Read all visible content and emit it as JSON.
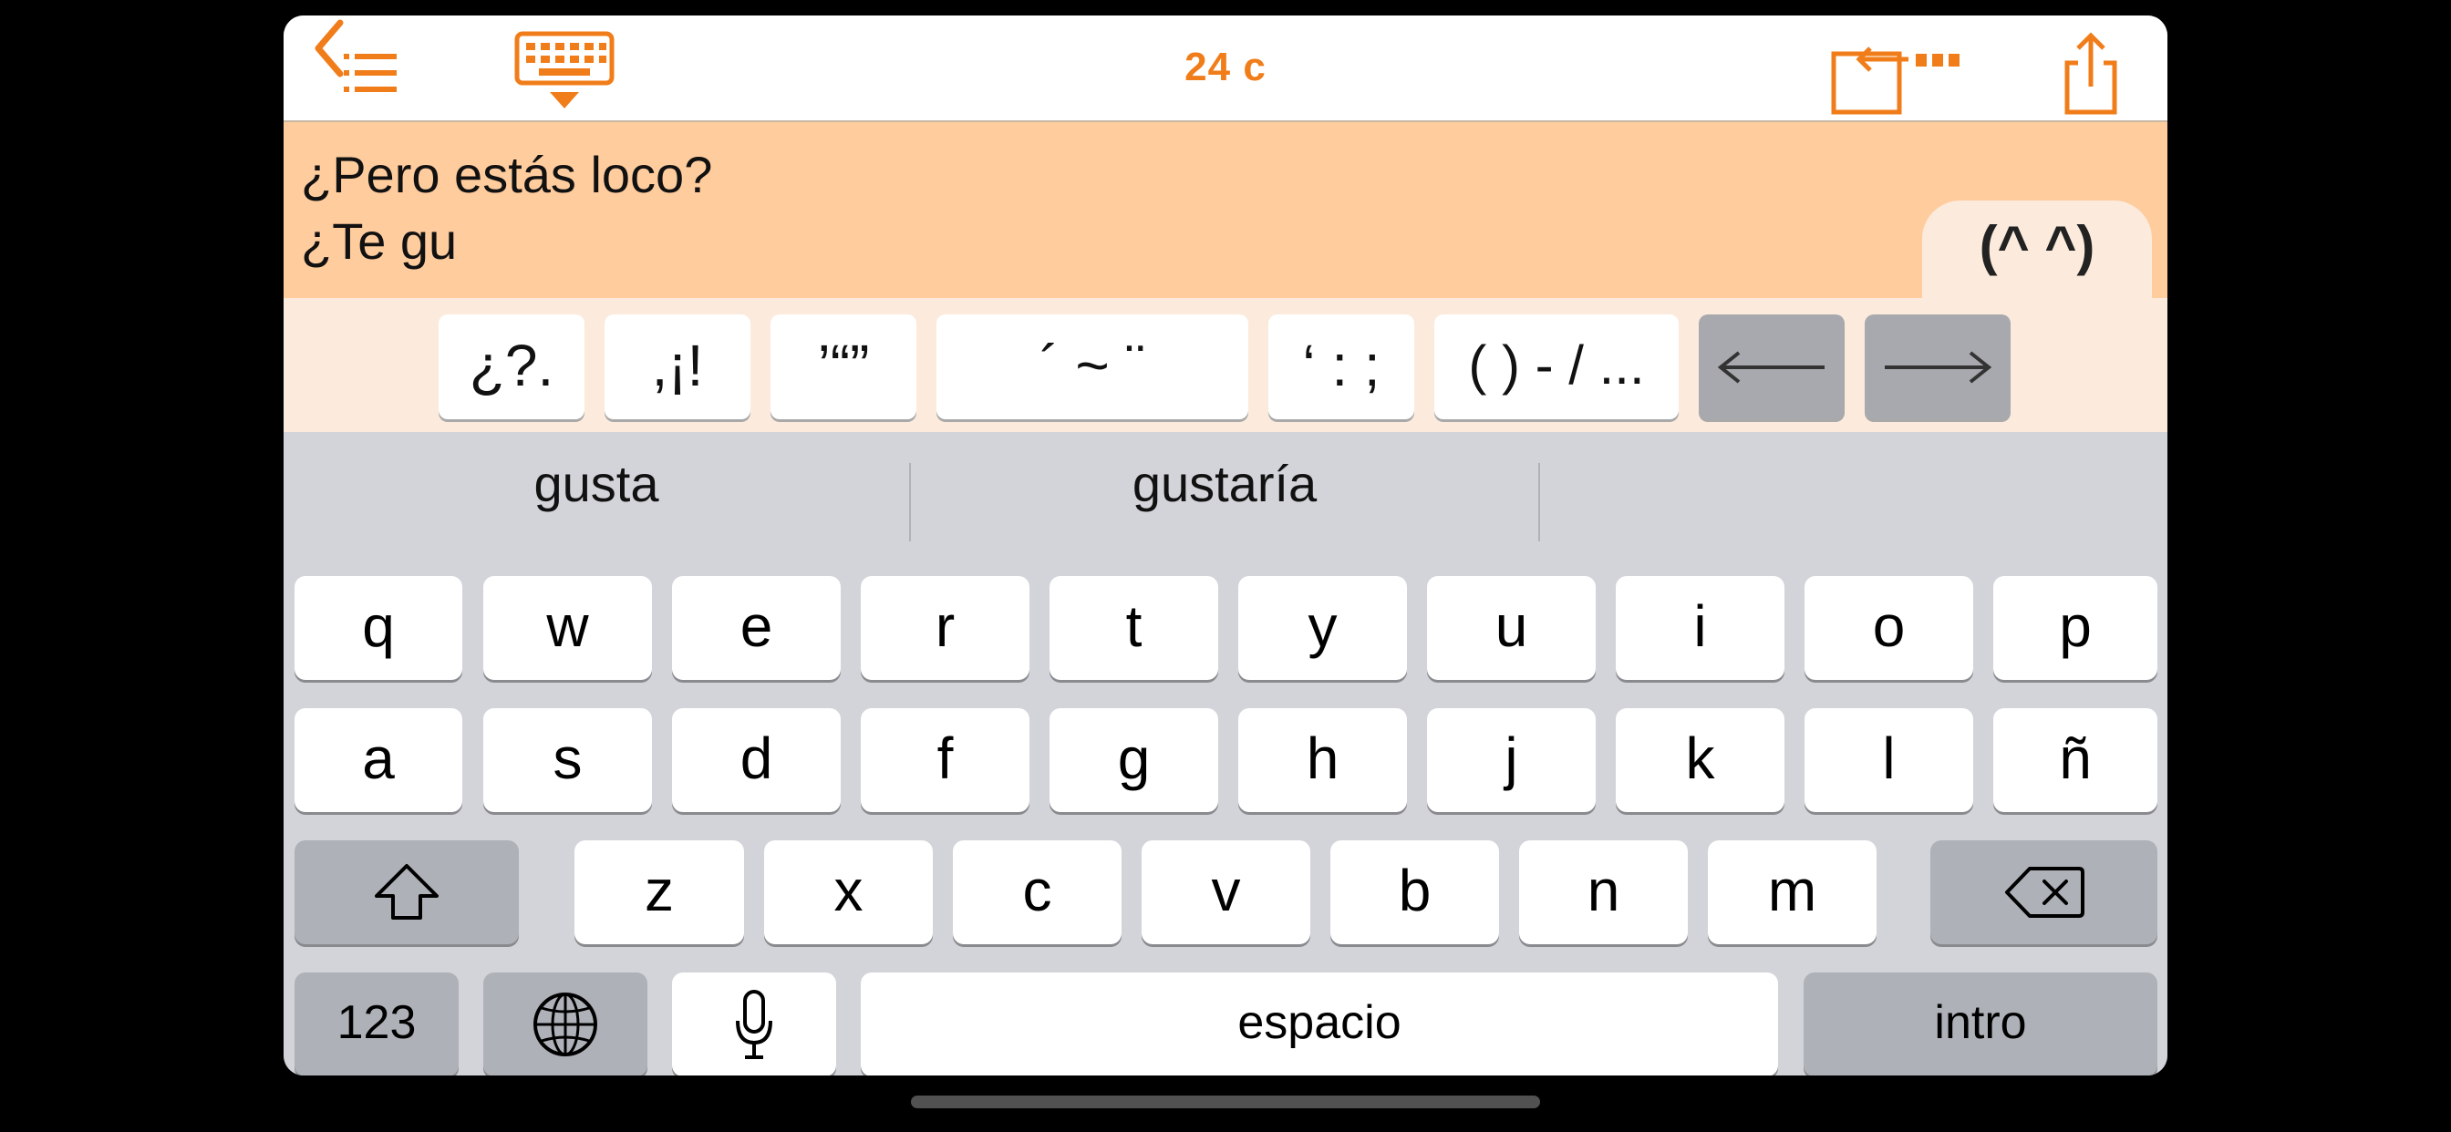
{
  "colors": {
    "accent": "#f07d1a",
    "text_area_bg": "#ffcc9e",
    "accent_bar_bg": "#fcebdc",
    "keyboard_bg": "#d2d4d9",
    "special_key_bg": "#aeb1b8"
  },
  "toolbar": {
    "back_icon": "chevron-left-icon",
    "list_icon": "list-icon",
    "keyboard_icon": "keyboard-dismiss-icon",
    "char_count": "24 c",
    "move_icon": "move-cursor-icon",
    "share_icon": "share-icon"
  },
  "editor": {
    "lines": [
      "¿Pero estás loco?",
      "¿Te gu"
    ],
    "emoticon_tab": "(^ ^)"
  },
  "accent_bar": {
    "keys": [
      "¿?.",
      ",¡!",
      "’“”",
      "´ ~ ¨",
      "‘ : ;",
      "( ) - / ..."
    ],
    "left_arrow_icon": "arrow-left-icon",
    "right_arrow_icon": "arrow-right-icon"
  },
  "suggestions": [
    "gusta",
    "gustaría",
    ""
  ],
  "keyboard": {
    "row1": [
      "q",
      "w",
      "e",
      "r",
      "t",
      "y",
      "u",
      "i",
      "o",
      "p"
    ],
    "row2": [
      "a",
      "s",
      "d",
      "f",
      "g",
      "h",
      "j",
      "k",
      "l",
      "ñ"
    ],
    "row3": [
      "z",
      "x",
      "c",
      "v",
      "b",
      "n",
      "m"
    ],
    "shift_icon": "shift-icon",
    "delete_icon": "delete-icon",
    "numbers_label": "123",
    "globe_icon": "globe-icon",
    "mic_icon": "microphone-icon",
    "space_label": "espacio",
    "return_label": "intro"
  }
}
